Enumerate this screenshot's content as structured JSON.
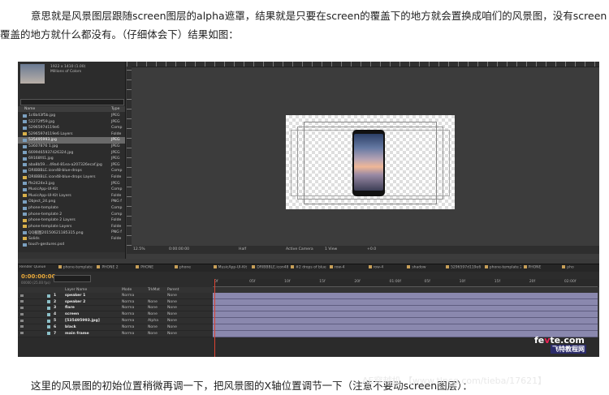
{
  "text": {
    "para_top_l1": "意思就是风景图层跟随screen图层的alpha遮罩，结果就是只要在screen的覆盖下的地方就会置换成咱们的风景图，没有screen",
    "para_top_l2": "覆盖的地方就什么都没有。（仔细体会下）结果如图：",
    "para_bottom": "这里的风景图的初始位置稍微再调一下，把风景图的X轴位置调节一下（注意不要动screen图层）："
  },
  "project": {
    "thumb_info_1": "1922 x 1410 (1.00)",
    "thumb_info_2": "Millions of Colors",
    "col_name": "Name",
    "col_type": "Type",
    "items": [
      {
        "name": "1c6b43f5b.jpg",
        "type": "JPEG",
        "folder": false
      },
      {
        "name": "52272ff59.jpg",
        "type": "JPEG",
        "folder": false
      },
      {
        "name": "5296597d119e6",
        "type": "Comp",
        "folder": false
      },
      {
        "name": "5296597d119e6 Layers",
        "type": "Folde",
        "folder": true
      },
      {
        "name": "535495993.jpg",
        "type": "JPEG",
        "folder": false,
        "selected": true
      },
      {
        "name": "53607876 1.jpg",
        "type": "JPEG",
        "folder": false
      },
      {
        "name": "6699465937426324.jpg",
        "type": "JPEG",
        "folder": false
      },
      {
        "name": "69168f41.jpg",
        "type": "JPEG",
        "folder": false
      },
      {
        "name": "aba8b59....49a4-81ea-a207326ecaf.jpg",
        "type": "JPEG",
        "folder": false
      },
      {
        "name": "DRIBBBLE.icon48-blue-drops",
        "type": "Comp",
        "folder": false
      },
      {
        "name": "DRIBBBLE.icon48-blue-drops Layers",
        "type": "Folde",
        "folder": true
      },
      {
        "name": "ffe2424e3.jpg",
        "type": "JPEG",
        "folder": false
      },
      {
        "name": "MusicApp-UI-Kit",
        "type": "Comp",
        "folder": false
      },
      {
        "name": "MusicApp-UI-Kit Layers",
        "type": "Folde",
        "folder": true
      },
      {
        "name": "Object_24.png",
        "type": "PNG f",
        "folder": false
      },
      {
        "name": "phone-template",
        "type": "Comp",
        "folder": false
      },
      {
        "name": "phone-template 2",
        "type": "Comp",
        "folder": false
      },
      {
        "name": "phone-template 2 Layers",
        "type": "Folde",
        "folder": true
      },
      {
        "name": "phone-template Layers",
        "type": "Folde",
        "folder": true
      },
      {
        "name": "QQ截图20150621185315.png",
        "type": "PNG f",
        "folder": false
      },
      {
        "name": "Solids",
        "type": "Folde",
        "folder": true
      },
      {
        "name": "touch-gestures.psd",
        "type": "",
        "folder": false
      }
    ]
  },
  "viewer": {
    "zoom": "12.5%",
    "time": "0:00:00:00",
    "res": "Half",
    "camera": "Active Camera",
    "view": "1 View",
    "exposure": "+0.0"
  },
  "tabs": [
    "Render Queue",
    "phone-template",
    "PHONE 2",
    "PHONE",
    "phone",
    "MusicApp-UI-Kit",
    "DRIBBBLE.icon48-blue-drops",
    "#2 drops of blue",
    "row-4",
    "row-4",
    "shadow",
    "5296597d119e6",
    "phone-template 2",
    "PHONE",
    "pho"
  ],
  "timeline": {
    "timecode": "0:00:00:00",
    "timecode_sub": "00000 (25.00 fps)",
    "ticks": [
      "0f",
      "05f",
      "10f",
      "15f",
      "20f",
      "01:00f",
      "05f",
      "10f",
      "15f",
      "20f",
      "02:00f"
    ],
    "headers": {
      "layer_name": "Layer Name",
      "mode": "Mode",
      "trkmat": "TrkMat",
      "parent": "Parent"
    },
    "layers": [
      {
        "num": "1",
        "name": "speaker 1",
        "mode": "Norma",
        "trkmat": "",
        "parent": "None"
      },
      {
        "num": "2",
        "name": "speaker 2",
        "mode": "Norma",
        "trkmat": "None",
        "parent": "None"
      },
      {
        "num": "3",
        "name": "flare",
        "mode": "Norma",
        "trkmat": "None",
        "parent": "None"
      },
      {
        "num": "4",
        "name": "screen",
        "mode": "Norma",
        "trkmat": "None",
        "parent": "None"
      },
      {
        "num": "5",
        "name": "[535495993.jpg]",
        "mode": "Norma",
        "trkmat": "Alpha",
        "parent": "None"
      },
      {
        "num": "6",
        "name": "black",
        "mode": "Norma",
        "trkmat": "None",
        "parent": "None"
      },
      {
        "num": "7",
        "name": "main frame",
        "mode": "Norma",
        "trkmat": "None",
        "parent": "None"
      }
    ]
  },
  "watermarks": {
    "fevte_pre": "fe",
    "fevte_hi": "v",
    "fevte_post": "te.com",
    "site": "飞特教程网",
    "bottom": "AE穿越机 【www.tlncg.com/tieba/17621】"
  }
}
